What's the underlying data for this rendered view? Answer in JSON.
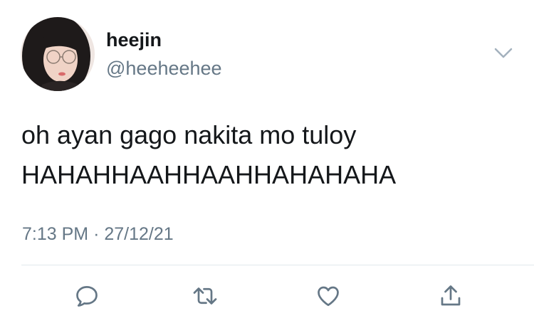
{
  "tweet": {
    "author": {
      "display_name": "heejin",
      "handle": "@heeheehee"
    },
    "text_lines": [
      "oh ayan gago nakita mo tuloy",
      "HAHAHHAAHHAAHHAHAHAHA"
    ],
    "meta": {
      "time": "7:13 PM",
      "separator": "·",
      "date": "27/12/21"
    }
  },
  "icons": {
    "menu": "chevron-down-icon",
    "reply": "reply-icon",
    "retweet": "retweet-icon",
    "like": "heart-icon",
    "share": "share-icon"
  },
  "colors": {
    "text_primary": "#14171a",
    "text_secondary": "#657786",
    "icon": "#657786",
    "divider": "#e1e8ed",
    "background": "#ffffff"
  }
}
